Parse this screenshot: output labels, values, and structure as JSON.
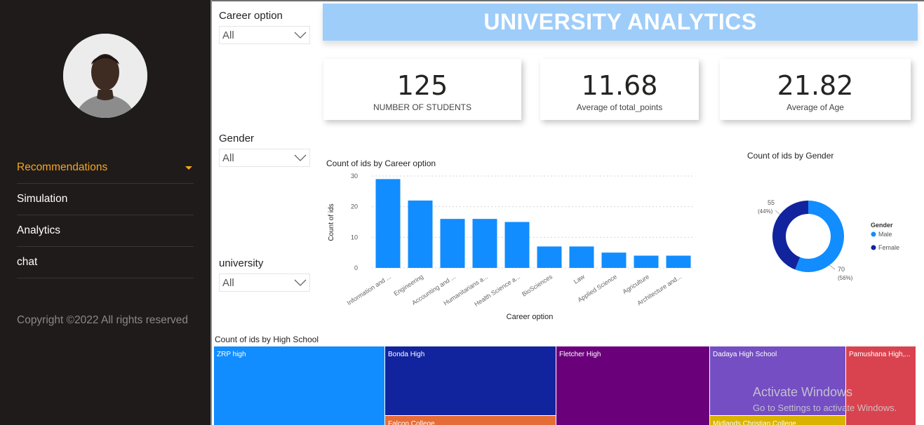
{
  "sidebar": {
    "nav": [
      {
        "label": "Recommendations",
        "active": true
      },
      {
        "label": "Simulation"
      },
      {
        "label": "Analytics"
      },
      {
        "label": "chat"
      }
    ],
    "copyright": "Copyright ©2022 All rights reserved"
  },
  "slicers": {
    "career": {
      "title": "Career option",
      "value": "All"
    },
    "gender": {
      "title": "Gender",
      "value": "All"
    },
    "university": {
      "title": "university",
      "value": "All"
    }
  },
  "banner": {
    "title": "UNIVERSITY ANALYTICS"
  },
  "kpis": [
    {
      "value": "125",
      "label": "NUMBER OF STUDENTS"
    },
    {
      "value": "11.68",
      "label": "Average of total_points"
    },
    {
      "value": "21.82",
      "label": "Average of Age"
    }
  ],
  "colors": {
    "bar": "#118dff",
    "male": "#118dff",
    "female": "#12239e",
    "accent": "#f5a623",
    "banner": "#9ecdfa"
  },
  "chart_data": [
    {
      "type": "bar",
      "title": "Count of ids by Career option",
      "xlabel": "Career option",
      "ylabel": "Count of ids",
      "categories": [
        "Information and ...",
        "Engineering",
        "Accounting and ...",
        "Humanitarians a...",
        "Health Science a...",
        "BioSciences",
        "Law",
        "Applied Science",
        "Agriculture",
        "Architecture and..."
      ],
      "values": [
        29,
        22,
        16,
        16,
        15,
        7,
        7,
        5,
        4,
        4
      ],
      "ylim": [
        0,
        30
      ],
      "yticks": [
        0,
        10,
        20,
        30
      ],
      "grid": true
    },
    {
      "type": "pie",
      "title": "Count of ids by Gender",
      "legend_title": "Gender",
      "legend_position": "right",
      "slices": [
        {
          "name": "Male",
          "value": 70,
          "label": "70",
          "pct": "(56%)"
        },
        {
          "name": "Female",
          "value": 55,
          "label": "55",
          "pct": "(44%)"
        }
      ]
    },
    {
      "type": "treemap",
      "title": "Count of ids by High School",
      "items": [
        {
          "name": "ZRP high",
          "color": "#118dff"
        },
        {
          "name": "Bonda High",
          "color": "#12239e"
        },
        {
          "name": "Fletcher High",
          "color": "#6b007b"
        },
        {
          "name": "Dadaya High School",
          "color": "#744ec2"
        },
        {
          "name": "Pamushana High,...",
          "color": "#d9434f"
        },
        {
          "name": "Falcon College",
          "color": "#e66c37"
        },
        {
          "name": "Midlands Christian College",
          "color": "#d9b300"
        }
      ]
    }
  ],
  "watermark": {
    "line1": "Activate Windows",
    "line2": "Go to Settings to activate Windows."
  }
}
